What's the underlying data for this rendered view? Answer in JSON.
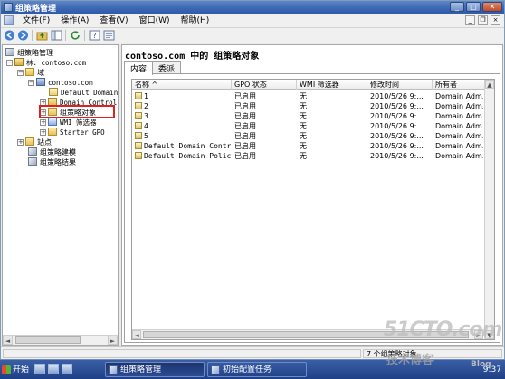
{
  "window": {
    "title": "组策略管理"
  },
  "menu": {
    "items": [
      "文件(F)",
      "操作(A)",
      "查看(V)",
      "窗口(W)",
      "帮助(H)"
    ]
  },
  "tree": {
    "root": "组策略管理",
    "forest": "林: contoso.com",
    "domains": "域",
    "domain": "contoso.com",
    "default_domain": "Default Domain",
    "domain_controllers": "Domain Control",
    "gpo_folder": "组策略对象",
    "wmi_filters": "WMI 筛选器",
    "starter_gpo": "Starter GPO",
    "sites": "站点",
    "modeling": "组策略建模",
    "results": "组策略结果"
  },
  "content": {
    "title": "contoso.com 中的 组策略对象",
    "tabs": [
      "内容",
      "委派"
    ],
    "columns": [
      "名称 ^",
      "GPO 状态",
      "WMI 筛选器",
      "修改时间",
      "所有者"
    ],
    "rows": [
      {
        "name": "1",
        "status": "已启用",
        "wmi": "无",
        "modified": "2010/5/26 9:...",
        "owner": "Domain Adm..."
      },
      {
        "name": "2",
        "status": "已启用",
        "wmi": "无",
        "modified": "2010/5/26 9:...",
        "owner": "Domain Adm..."
      },
      {
        "name": "3",
        "status": "已启用",
        "wmi": "无",
        "modified": "2010/5/26 9:...",
        "owner": "Domain Adm..."
      },
      {
        "name": "4",
        "status": "已启用",
        "wmi": "无",
        "modified": "2010/5/26 9:...",
        "owner": "Domain Adm..."
      },
      {
        "name": "5",
        "status": "已启用",
        "wmi": "无",
        "modified": "2010/5/26 9:...",
        "owner": "Domain Adm..."
      },
      {
        "name": "Default Domain Contr...",
        "status": "已启用",
        "wmi": "无",
        "modified": "2010/5/26 9:...",
        "owner": "Domain Adm..."
      },
      {
        "name": "Default Domain Policy",
        "status": "已启用",
        "wmi": "无",
        "modified": "2010/5/26 9:...",
        "owner": "Domain Adm..."
      }
    ]
  },
  "status": {
    "count_text": "7 个组策略对象"
  },
  "taskbar": {
    "start": "开始",
    "items": [
      "组策略管理",
      "初始配置任务"
    ],
    "clock": "9:37"
  },
  "watermark": {
    "line1": "51CTO.com",
    "line2": "技术博客",
    "line3": "Blog"
  },
  "colors": {
    "title_bar": "#3a66b4",
    "highlight_box": "#e02020",
    "taskbar": "#1f3f86"
  }
}
